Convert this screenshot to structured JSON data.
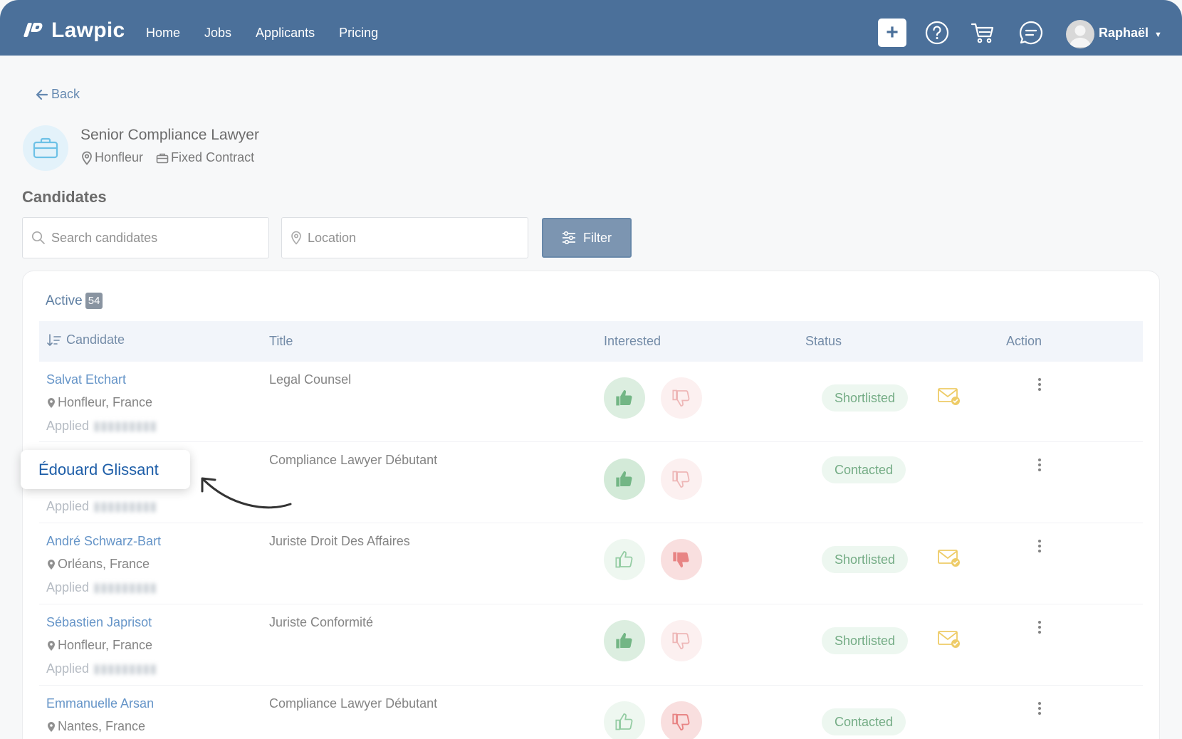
{
  "nav": {
    "brand": "Lawpic",
    "links": [
      "Home",
      "Jobs",
      "Applicants",
      "Pricing"
    ],
    "user_name": "Raphaël",
    "icons": [
      "plus-icon",
      "help-icon",
      "cart-icon",
      "chat-icon",
      "avatar",
      "chevron-down-icon"
    ]
  },
  "back_label": "Back",
  "job": {
    "title": "Senior Compliance Lawyer",
    "location": "Honfleur",
    "contract": "Fixed Contract"
  },
  "section_title": "Candidates",
  "search": {
    "placeholder": "Search candidates"
  },
  "location_filter": {
    "placeholder": "Location"
  },
  "filter_label": "Filter",
  "tab": {
    "label": "Active",
    "count": "54"
  },
  "table": {
    "headers": [
      "Candidate",
      "Title",
      "Interested",
      "Status",
      "Action"
    ],
    "applied_label": "Applied",
    "rows": [
      {
        "name": "Salvat Etchart",
        "location": "Honfleur, France",
        "title": "Legal Counsel",
        "interested": "up",
        "status": "Shortlisted",
        "mail": true
      },
      {
        "name": "Édouard Glissant",
        "location": "",
        "title": "Compliance Lawyer Débutant",
        "interested": "up",
        "status": "Contacted",
        "mail": false
      },
      {
        "name": "André Schwarz-Bart",
        "location": "Orléans, France",
        "title": "Juriste Droit Des Affaires",
        "interested": "down",
        "status": "Shortlisted",
        "mail": true
      },
      {
        "name": "Sébastien Japrisot",
        "location": "Honfleur, France",
        "title": "Juriste Conformité",
        "interested": "up",
        "status": "Shortlisted",
        "mail": true
      },
      {
        "name": "Emmanuelle Arsan",
        "location": "Nantes, France",
        "title": "Compliance Lawyer Débutant",
        "interested": "none",
        "status": "Contacted",
        "mail": false
      }
    ]
  },
  "highlight": {
    "name": "Édouard Glissant"
  },
  "colors": {
    "navbar": "#063a73",
    "link": "#2b6cb3",
    "filter_button": "#4a6d94",
    "status_green": "#3f8c56",
    "thumb_up": "#3e9a57",
    "thumb_down": "#e05555",
    "mail_yellow": "#e8b92e"
  }
}
